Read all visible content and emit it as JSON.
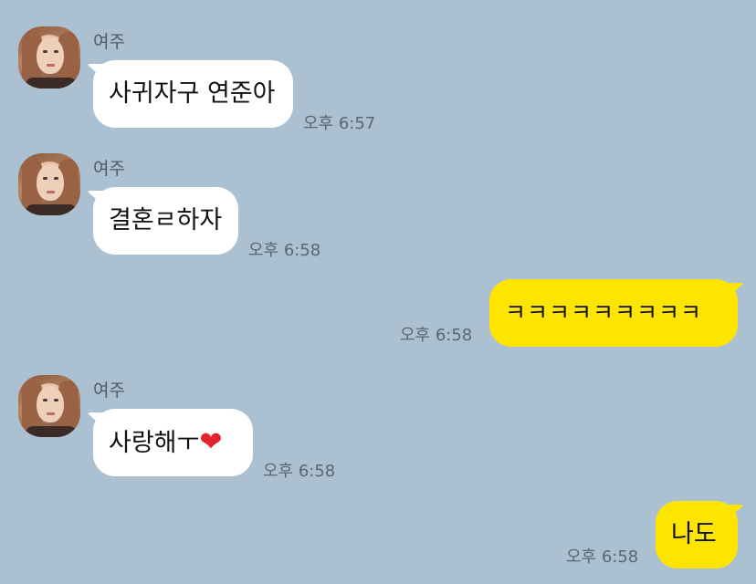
{
  "messages": [
    {
      "sender": "여주",
      "text": "사귀자구 연준아",
      "time": "오후 6:57"
    },
    {
      "sender": "여주",
      "text": "결혼ㄹ하자",
      "time": "오후 6:58"
    },
    {
      "sender": "me",
      "text": "ㅋㅋㅋㅋㅋㅋㅋㅋㅋ",
      "time": "오후 6:58"
    },
    {
      "sender": "여주",
      "text": "사랑해ㅜ",
      "emoji": "❤",
      "time": "오후 6:58"
    },
    {
      "sender": "me",
      "text": "나도",
      "time": "오후 6:58"
    }
  ],
  "colors": {
    "background": "#abc1d1",
    "incoming_bubble": "#ffffff",
    "outgoing_bubble": "#fee500",
    "heart": "#e4232b"
  },
  "icons": {
    "avatar": "profile-photo",
    "emoji": "red-heart"
  }
}
